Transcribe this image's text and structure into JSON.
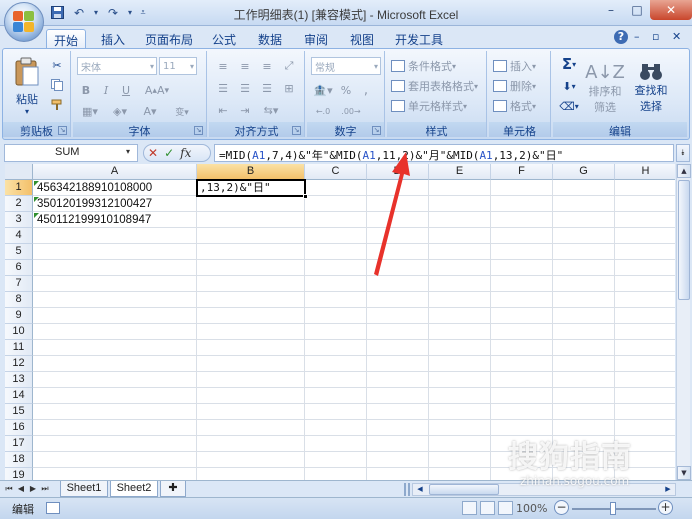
{
  "window": {
    "title": "工作明细表(1)  [兼容模式] - Microsoft Excel",
    "min": "–",
    "max": "□",
    "close": "✕"
  },
  "ribbon_tabs": [
    "开始",
    "插入",
    "页面布局",
    "公式",
    "数据",
    "审阅",
    "视图",
    "开发工具"
  ],
  "ribbon_right": {
    "help": "?",
    "min": "–",
    "restore": "▫",
    "close": "✕"
  },
  "groups": {
    "clipboard": {
      "label": "剪贴板",
      "paste": "粘贴"
    },
    "font": {
      "label": "字体",
      "font_name": "宋体",
      "font_size": "11",
      "bold": "B",
      "italic": "I",
      "underline": "U"
    },
    "alignment": {
      "label": "对齐方式"
    },
    "number": {
      "label": "数字",
      "format": "常规",
      "percent": "%"
    },
    "styles": {
      "label": "样式",
      "conditional": "条件格式",
      "table_format": "套用表格格式",
      "cell_style": "单元格样式"
    },
    "cells": {
      "label": "单元格",
      "insert": "插入",
      "delete": "删除",
      "format": "格式"
    },
    "editing": {
      "label": "编辑",
      "sort": "排序和",
      "filter": "筛选",
      "find": "查找和",
      "select": "选择"
    }
  },
  "formula_bar": {
    "name_box": "SUM",
    "cancel": "✕",
    "enter": "✓",
    "fx": "fx",
    "formula_parts": [
      "=MID(",
      "A1",
      ",7,4)&\"年\"&MID(",
      "A1",
      ",11,2)&\"月\"&MID(",
      "A1",
      ",13,2)&\"日\""
    ]
  },
  "columns": [
    "A",
    "B",
    "C",
    "D",
    "E",
    "F",
    "G",
    "H"
  ],
  "rows": [
    "1",
    "2",
    "3",
    "4",
    "5",
    "6",
    "7",
    "8",
    "9",
    "10",
    "11",
    "12",
    "13",
    "14",
    "15",
    "16",
    "17",
    "18",
    "19"
  ],
  "cells": {
    "A1": "456342188910108000",
    "A2": "350120199312100427",
    "A3": "450112199910108947",
    "B1_edit": ",13,2)&\"日\""
  },
  "sheets": {
    "tabs": [
      "Sheet1",
      "Sheet2"
    ],
    "active": "Sheet2"
  },
  "status": {
    "mode": "编辑",
    "zoom": "100%",
    "minus": "−",
    "plus": "+"
  },
  "watermark": {
    "text": "搜狗指南",
    "url": "zhinan.sogou.com"
  },
  "colors": {
    "accent": "#15428b",
    "ribbon_bg": "#dbe7f6",
    "arrow": "#e8322b",
    "selected_header": "#f3c06a"
  }
}
